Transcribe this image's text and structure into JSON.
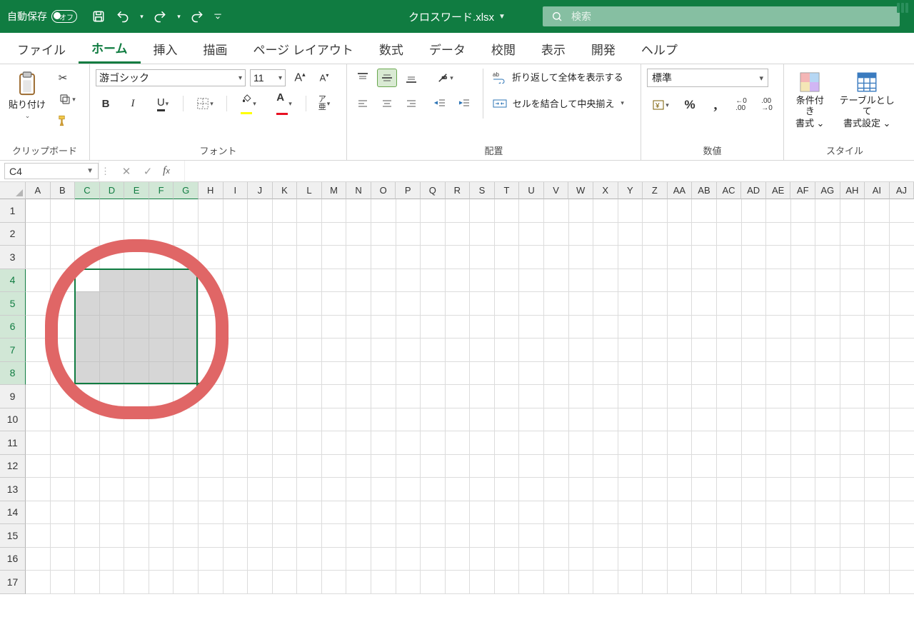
{
  "titlebar": {
    "autosave_label": "自動保存",
    "autosave_state": "オフ",
    "filename": "クロスワード.xlsx",
    "search_placeholder": "検索"
  },
  "tabs": [
    "ファイル",
    "ホーム",
    "挿入",
    "描画",
    "ページ レイアウト",
    "数式",
    "データ",
    "校閲",
    "表示",
    "開発",
    "ヘルプ"
  ],
  "active_tab": "ホーム",
  "ribbon": {
    "clipboard": {
      "paste": "貼り付け",
      "label": "クリップボード"
    },
    "font": {
      "name": "游ゴシック",
      "size": "11",
      "label": "フォント"
    },
    "alignment": {
      "wrap": "折り返して全体を表示する",
      "merge": "セルを結合して中央揃え",
      "label": "配置"
    },
    "number": {
      "format": "標準",
      "label": "数値"
    },
    "styles": {
      "cond_l1": "条件付き",
      "cond_l2": "書式 ⌄",
      "table_l1": "テーブルとして",
      "table_l2": "書式設定 ⌄",
      "label": "スタイル"
    }
  },
  "formula_bar": {
    "namebox": "C4",
    "formula": ""
  },
  "grid": {
    "columns": [
      "A",
      "B",
      "C",
      "D",
      "E",
      "F",
      "G",
      "H",
      "I",
      "J",
      "K",
      "L",
      "M",
      "N",
      "O",
      "P",
      "Q",
      "R",
      "S",
      "T",
      "U",
      "V",
      "W",
      "X",
      "Y",
      "Z",
      "AA",
      "AB",
      "AC",
      "AD",
      "AE",
      "AF",
      "AG",
      "AH",
      "AI",
      "AJ"
    ],
    "rows": [
      "1",
      "2",
      "3",
      "4",
      "5",
      "6",
      "7",
      "8",
      "9",
      "10",
      "11",
      "12",
      "13",
      "14",
      "15",
      "16",
      "17"
    ],
    "selected_cols": [
      "C",
      "D",
      "E",
      "F",
      "G"
    ],
    "selected_rows": [
      "4",
      "5",
      "6",
      "7",
      "8"
    ],
    "selection": {
      "c1": 2,
      "r1": 3,
      "c2": 6,
      "r2": 7
    },
    "active_cell": {
      "c": 2,
      "r": 3
    }
  }
}
